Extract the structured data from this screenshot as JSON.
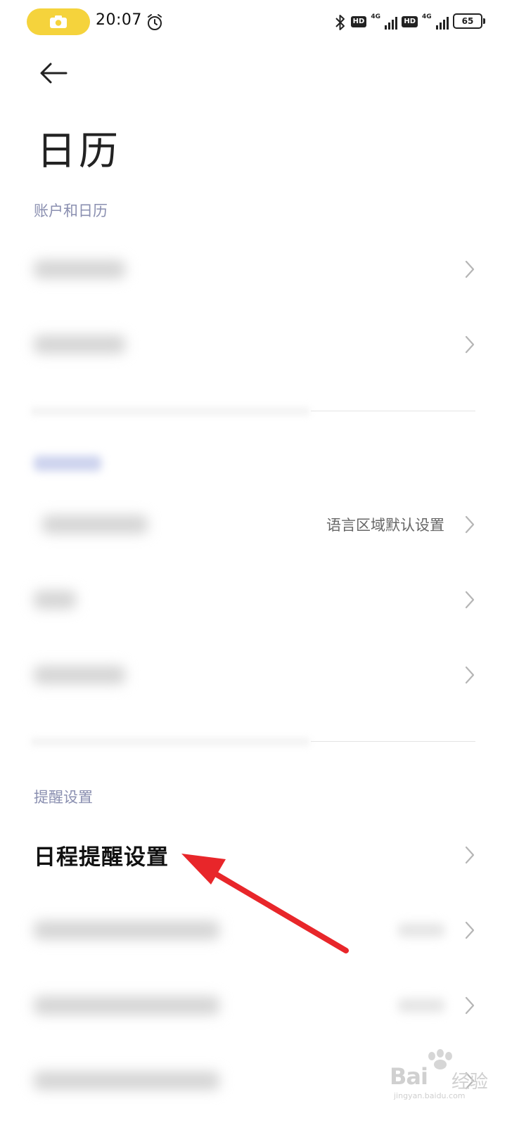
{
  "status_bar": {
    "time": "20:07",
    "hd1": "HD",
    "net1": "4G",
    "hd2": "HD",
    "net2": "4G",
    "battery": "65",
    "icons": [
      "camera-icon",
      "alarm-icon",
      "bluetooth-icon",
      "signal-icon",
      "battery-icon"
    ]
  },
  "header": {
    "title": "日历",
    "back_icon": "back-arrow-icon"
  },
  "sections": {
    "accounts": {
      "header": "账户和日历"
    },
    "reminders": {
      "header": "提醒设置"
    }
  },
  "rows": {
    "locale_value": "语言区域默认设置",
    "event_reminder_label": "日程提醒设置"
  },
  "watermark": {
    "brand": "Bai",
    "brand_suffix": "经验",
    "url": "jingyan.baidu.com"
  },
  "colors": {
    "section_header": "#8a8fb0",
    "chevron": "#b5b5b5",
    "annotation_arrow": "#e8262a",
    "camera_pill": "#f5d33c"
  }
}
